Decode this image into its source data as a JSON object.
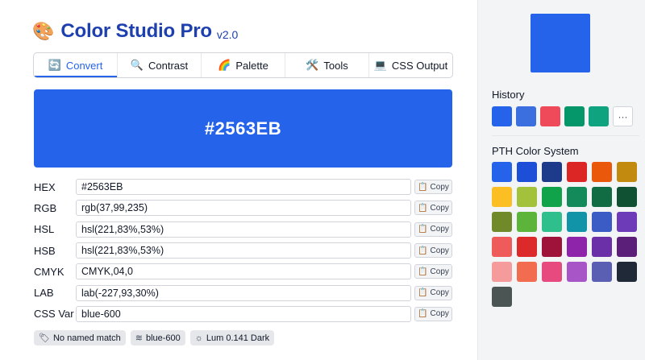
{
  "app": {
    "logo_glyph": "🎨",
    "title": "Color Studio Pro",
    "version": "v2.0"
  },
  "tabs": [
    {
      "label": "Convert",
      "icon": "refresh-icon",
      "glyph": "🔄",
      "active": true
    },
    {
      "label": "Contrast",
      "icon": "search-icon",
      "glyph": "🔍",
      "active": false
    },
    {
      "label": "Palette",
      "icon": "rainbow-icon",
      "glyph": "🌈",
      "active": false
    },
    {
      "label": "Tools",
      "icon": "tools-icon",
      "glyph": "🛠️",
      "active": false
    },
    {
      "label": "CSS Output",
      "icon": "laptop-icon",
      "glyph": "💻",
      "active": false
    }
  ],
  "current": {
    "hex": "#2563EB",
    "color": "#2563eb"
  },
  "fields": [
    {
      "label": "HEX",
      "value": "#2563EB"
    },
    {
      "label": "RGB",
      "value": "rgb(37,99,235)"
    },
    {
      "label": "HSL",
      "value": "hsl(221,83%,53%)"
    },
    {
      "label": "HSB",
      "value": "hsl(221,83%,53%)"
    },
    {
      "label": "CMYK",
      "value": "CMYK,04,0"
    },
    {
      "label": "LAB",
      "value": "lab(-227,93,30%)"
    },
    {
      "label": "CSS Var",
      "value": "blue-600"
    }
  ],
  "copy_label": "Copy",
  "copy_glyph": "📋",
  "badges": [
    {
      "label": "No named match",
      "icon": "tag-icon",
      "glyph": "🏷"
    },
    {
      "label": "blue-600",
      "icon": "wind-icon",
      "glyph": "≋"
    },
    {
      "label": "Lum 0.141 Dark",
      "icon": "sun-icon",
      "glyph": "☼"
    }
  ],
  "sidebar": {
    "preview_color": "#2563eb",
    "history_title": "History",
    "more_glyph": "···",
    "history": [
      "#2563eb",
      "#3b6fdf",
      "#ef4a5a",
      "#059669",
      "#10a37f"
    ],
    "system_title": "PTH Color System",
    "system_colors": [
      "#2563eb",
      "#1d4ed8",
      "#1e3a8a",
      "#dc2626",
      "#ea580c",
      "#c28a0e",
      "#fbbf24",
      "#a3c13a",
      "#10a34a",
      "#148a5a",
      "#116c44",
      "#0f5132",
      "#708a2a",
      "#5cb53a",
      "#2fbf8c",
      "#1193a8",
      "#3a5cc4",
      "#6d3ab8",
      "#ef5a5a",
      "#dc2a2a",
      "#9f1239",
      "#8e24aa",
      "#6b2fa8",
      "#5b1f7a",
      "#f59b9b",
      "#f26d4f",
      "#e64a7f",
      "#a855c7",
      "#5a5fb3",
      "#1f2937",
      "#4b5553"
    ]
  }
}
